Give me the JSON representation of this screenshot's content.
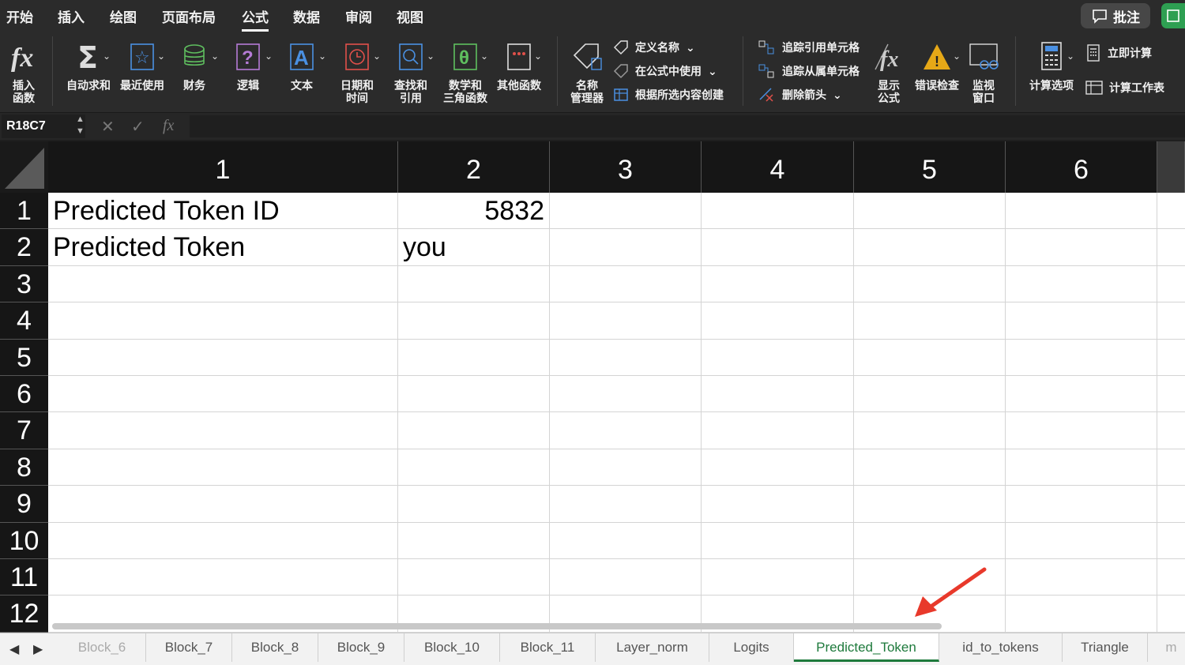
{
  "menu": {
    "tabs": [
      "开始",
      "插入",
      "绘图",
      "页面布局",
      "公式",
      "数据",
      "审阅",
      "视图"
    ],
    "active_tab": "公式",
    "comment_button": "批注"
  },
  "ribbon": {
    "insert_function": "插入\n函数",
    "autosum": "自动求和",
    "recent": "最近使用",
    "financial": "财务",
    "logical": "逻辑",
    "text": "文本",
    "datetime": "日期和\n时间",
    "lookup": "查找和\n引用",
    "math": "数学和\n三角函数",
    "other": "其他函数",
    "name_manager": "名称\n管理器",
    "define_name": "定义名称",
    "use_in_formula": "在公式中使用",
    "create_from_selection": "根据所选内容创建",
    "trace_precedents": "追踪引用单元格",
    "trace_dependents": "追踪从属单元格",
    "remove_arrows": "删除箭头",
    "show_formulas": "显示\n公式",
    "error_checking": "错误检查",
    "watch_window": "监视\n窗口",
    "calc_options": "计算选项",
    "calc_now": "立即计算",
    "calc_sheet": "计算工作表"
  },
  "formula_bar": {
    "name_box": "R18C7",
    "formula": ""
  },
  "grid": {
    "columns": [
      "1",
      "2",
      "3",
      "4",
      "5",
      "6"
    ],
    "rows": [
      "1",
      "2",
      "3",
      "4",
      "5",
      "6",
      "7",
      "8",
      "9",
      "10",
      "11",
      "12"
    ],
    "cells": {
      "r1c1": "Predicted Token ID",
      "r1c2": "5832",
      "r2c1": "Predicted Token",
      "r2c2": "you"
    }
  },
  "sheets": {
    "tabs": [
      "Block_6",
      "Block_7",
      "Block_8",
      "Block_9",
      "Block_10",
      "Block_11",
      "Layer_norm",
      "Logits",
      "Predicted_Token",
      "id_to_tokens",
      "Triangle",
      "m"
    ],
    "active": "Predicted_Token"
  },
  "colors": {
    "accent_green": "#1e7a3c",
    "annotation_arrow": "#e8392b"
  }
}
